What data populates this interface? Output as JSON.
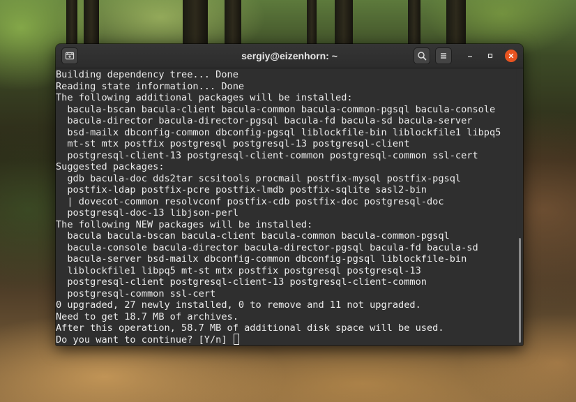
{
  "window": {
    "title": "sergiy@eizenhorn: ~"
  },
  "headerbar": {
    "new_tab_icon": "new-tab-icon",
    "search_icon": "search-icon",
    "menu_icon": "hamburger-menu-icon",
    "minimize_icon": "minimize-icon",
    "maximize_icon": "maximize-icon",
    "close_icon": "close-icon",
    "close_color": "#e95420"
  },
  "terminal": {
    "lines": [
      "Building dependency tree... Done",
      "Reading state information... Done",
      "The following additional packages will be installed:",
      "  bacula-bscan bacula-client bacula-common bacula-common-pgsql bacula-console",
      "  bacula-director bacula-director-pgsql bacula-fd bacula-sd bacula-server",
      "  bsd-mailx dbconfig-common dbconfig-pgsql liblockfile-bin liblockfile1 libpq5",
      "  mt-st mtx postfix postgresql postgresql-13 postgresql-client",
      "  postgresql-client-13 postgresql-client-common postgresql-common ssl-cert",
      "Suggested packages:",
      "  gdb bacula-doc dds2tar scsitools procmail postfix-mysql postfix-pgsql",
      "  postfix-ldap postfix-pcre postfix-lmdb postfix-sqlite sasl2-bin",
      "  | dovecot-common resolvconf postfix-cdb postfix-doc postgresql-doc",
      "  postgresql-doc-13 libjson-perl",
      "The following NEW packages will be installed:",
      "  bacula bacula-bscan bacula-client bacula-common bacula-common-pgsql",
      "  bacula-console bacula-director bacula-director-pgsql bacula-fd bacula-sd",
      "  bacula-server bsd-mailx dbconfig-common dbconfig-pgsql liblockfile-bin",
      "  liblockfile1 libpq5 mt-st mtx postfix postgresql postgresql-13",
      "  postgresql-client postgresql-client-13 postgresql-client-common",
      "  postgresql-common ssl-cert",
      "0 upgraded, 27 newly installed, 0 to remove and 11 not upgraded.",
      "Need to get 18.7 MB of archives.",
      "After this operation, 58.7 MB of additional disk space will be used.",
      "Do you want to continue? [Y/n] "
    ],
    "text_color": "#ececec",
    "background_color": "#2f2f2f"
  }
}
